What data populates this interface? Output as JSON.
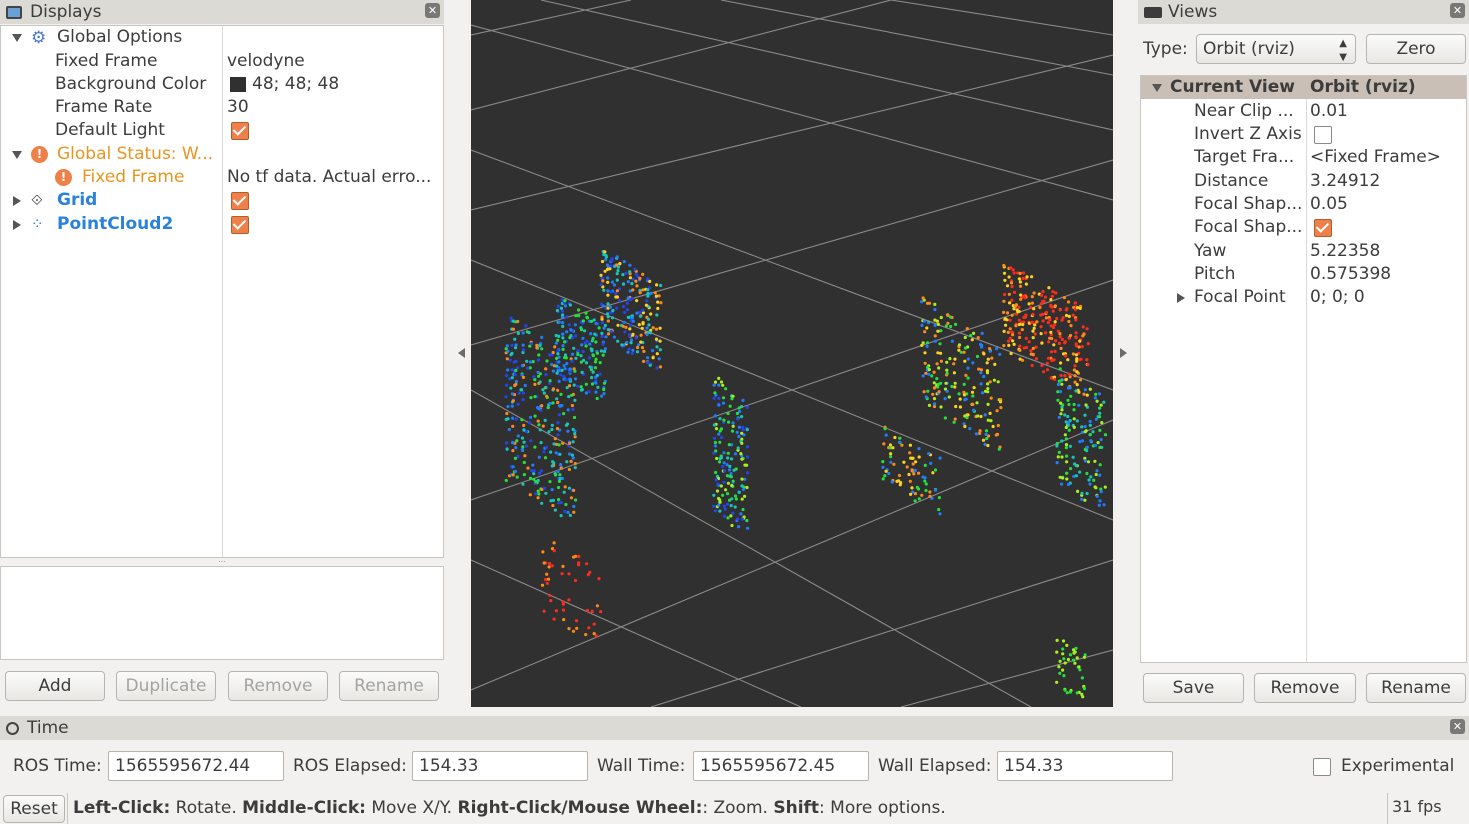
{
  "displays": {
    "title": "Displays",
    "tree": [
      {
        "label": "Global Options",
        "value": ""
      },
      {
        "label": "Fixed Frame",
        "value": "velodyne"
      },
      {
        "label": "Background Color",
        "value": "48; 48; 48"
      },
      {
        "label": "Frame Rate",
        "value": "30"
      },
      {
        "label": "Default Light",
        "value": ""
      },
      {
        "label": "Global Status: W...",
        "value": ""
      },
      {
        "label": "Fixed Frame",
        "value": "No tf data.  Actual erro..."
      },
      {
        "label": "Grid",
        "value": ""
      },
      {
        "label": "PointCloud2",
        "value": ""
      }
    ],
    "buttons": {
      "add": "Add",
      "duplicate": "Duplicate",
      "remove": "Remove",
      "rename": "Rename"
    }
  },
  "views": {
    "title": "Views",
    "type_label": "Type:",
    "type_value": "Orbit (rviz)",
    "zero_label": "Zero",
    "header": {
      "key": "Current View",
      "value": "Orbit (rviz)"
    },
    "props": [
      {
        "label": "Near Clip ...",
        "value": "0.01"
      },
      {
        "label": "Invert Z Axis",
        "value": ""
      },
      {
        "label": "Target Fra...",
        "value": "<Fixed Frame>"
      },
      {
        "label": "Distance",
        "value": "3.24912"
      },
      {
        "label": "Focal Shap...",
        "value": "0.05"
      },
      {
        "label": "Focal Shap...",
        "value": ""
      },
      {
        "label": "Yaw",
        "value": "5.22358"
      },
      {
        "label": "Pitch",
        "value": "0.575398"
      },
      {
        "label": "Focal Point",
        "value": "0; 0; 0"
      }
    ],
    "buttons": {
      "save": "Save",
      "remove": "Remove",
      "rename": "Rename"
    }
  },
  "time": {
    "title": "Time",
    "ros_time_label": "ROS Time:",
    "ros_time": "1565595672.44",
    "ros_elapsed_label": "ROS Elapsed:",
    "ros_elapsed": "154.33",
    "wall_time_label": "Wall Time:",
    "wall_time": "1565595672.45",
    "wall_elapsed_label": "Wall Elapsed:",
    "wall_elapsed": "154.33",
    "experimental_label": "Experimental"
  },
  "status": {
    "reset_label": "Reset",
    "left_click": "Left-Click:",
    "left_click_desc": " Rotate. ",
    "middle_click": "Middle-Click:",
    "middle_click_desc": " Move X/Y. ",
    "right_click": "Right-Click/Mouse Wheel:",
    "right_click_desc": ": Zoom. ",
    "shift": "Shift",
    "shift_desc": ": More options.",
    "fps": "31 fps"
  },
  "viewport": {
    "background": "#303030",
    "grid_color": "#8a8a8a"
  }
}
